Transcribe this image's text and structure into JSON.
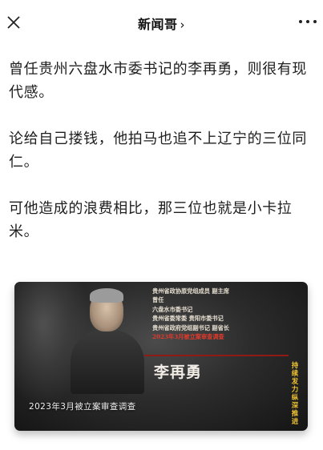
{
  "header": {
    "title": "新闻哥",
    "chevron": "›"
  },
  "article": {
    "paragraphs": [
      "曾任贵州六盘水市委书记的李再勇，则很有现代感。",
      "论给自己搂钱，他拍马也追不上辽宁的三位同仁。",
      "可他造成的浪费相比，那三位也就是小卡拉米。"
    ]
  },
  "video": {
    "bio_lines": [
      "贵州省政协原党组成员  副主席",
      "曾任",
      "六盘水市委书记",
      "贵州省委常委  贵阳市委书记",
      "贵州省政府党组副书记  副省长"
    ],
    "bio_highlight": "2023年3月被立案审查调查",
    "name": "李再勇",
    "side_tag": "持续发力纵深推进",
    "caption": "2023年3月被立案审查调查"
  },
  "colors": {
    "highlight": "#e23a2c",
    "tag": "#f0c330"
  }
}
